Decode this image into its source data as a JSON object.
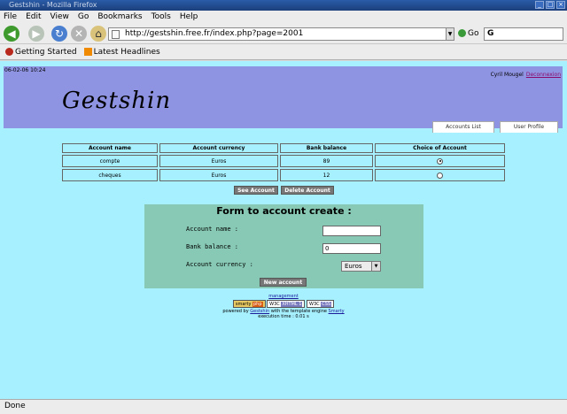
{
  "window": {
    "title": "Gestshin - Mozilla Firefox"
  },
  "menu": [
    "File",
    "Edit",
    "View",
    "Go",
    "Bookmarks",
    "Tools",
    "Help"
  ],
  "nav": {
    "url": "http://gestshin.free.fr/index.php?page=2001",
    "go_label": "Go",
    "search_value": "G"
  },
  "bookmarks": [
    "Getting Started",
    "Latest Headlines"
  ],
  "header": {
    "datetime": "06-02-06 10:24",
    "user_name": "Cyril Mougel",
    "logout_label": "Deconnexion",
    "logo": "Gestshin",
    "tabs": [
      "Accounts List",
      "User Profile"
    ]
  },
  "accounts": {
    "columns": [
      "Account name",
      "Account currency",
      "Bank balance",
      "Choice of Account"
    ],
    "rows": [
      {
        "name": "compte",
        "currency": "Euros",
        "balance": "89",
        "selected": true
      },
      {
        "name": "cheques",
        "currency": "Euros",
        "balance": "12",
        "selected": false
      }
    ],
    "see_label": "See Account",
    "delete_label": "Delete Account"
  },
  "form": {
    "title": "Form to account create :",
    "name_label": "Account name :",
    "name_value": "",
    "balance_label": "Bank balance :",
    "balance_value": "0",
    "currency_label": "Account currency :",
    "currency_value": "Euros",
    "submit_label": "New account"
  },
  "footer": {
    "link": "management",
    "badges": [
      "smarty",
      "php",
      "W3C",
      "XHTML 1",
      "W3C",
      "CSS"
    ],
    "powered_prefix": "powered by",
    "powered_link": "Gestshin",
    "powered_mid": "with the template engine",
    "engine_link": "Smarty",
    "exec_time": "execution time : 0.01 s"
  },
  "status": {
    "text": "Done"
  },
  "colors": {
    "header_bg": "#8f94e2",
    "page_bg": "#a6f0ff",
    "form_bg": "#87c9b4"
  }
}
